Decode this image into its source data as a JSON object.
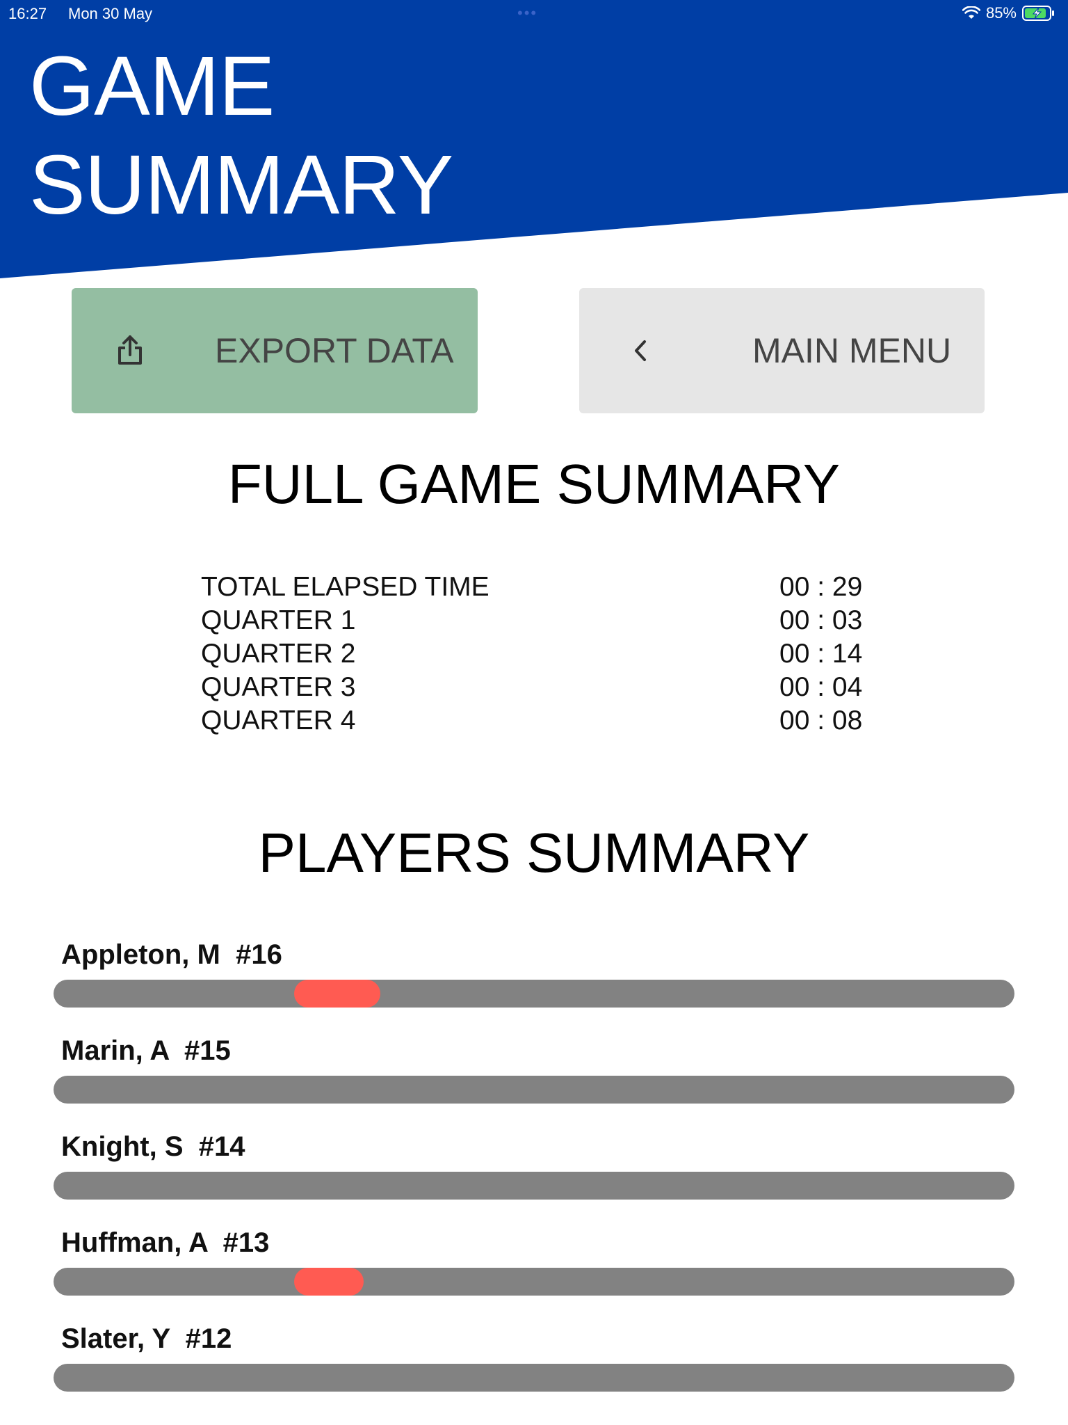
{
  "status_bar": {
    "time": "16:27",
    "date": "Mon 30 May",
    "battery": "85%",
    "wifi_icon": "wifi-icon",
    "battery_icon": "battery-charging-icon"
  },
  "colors": {
    "header_blue": "#003ea5",
    "export_green": "#94bea2",
    "menu_gray": "#e6e6e6",
    "track_gray": "#828282",
    "segment_red": "#ff5b52"
  },
  "header": {
    "title": "GAME\nSUMMARY"
  },
  "buttons": {
    "export": {
      "label": "EXPORT DATA",
      "icon": "share-icon"
    },
    "main_menu": {
      "label": "MAIN MENU",
      "icon": "chevron-left-icon"
    }
  },
  "game_summary": {
    "heading": "FULL GAME SUMMARY",
    "rows": [
      {
        "label": "TOTAL ELAPSED TIME",
        "value": "00 : 29"
      },
      {
        "label": "QUARTER 1",
        "value": "00 : 03"
      },
      {
        "label": "QUARTER 2",
        "value": "00 : 14"
      },
      {
        "label": "QUARTER 3",
        "value": "00 : 04"
      },
      {
        "label": "QUARTER 4",
        "value": "00 : 08"
      }
    ]
  },
  "players_summary": {
    "heading": "PLAYERS SUMMARY",
    "players": [
      {
        "name": "Appleton, M  #16",
        "segments": [
          {
            "start": 0.25,
            "end": 0.34
          }
        ]
      },
      {
        "name": "Marin, A  #15",
        "segments": []
      },
      {
        "name": "Knight, S  #14",
        "segments": []
      },
      {
        "name": "Huffman, A  #13",
        "segments": [
          {
            "start": 0.25,
            "end": 0.323
          }
        ]
      },
      {
        "name": "Slater, Y  #12",
        "segments": []
      }
    ]
  }
}
